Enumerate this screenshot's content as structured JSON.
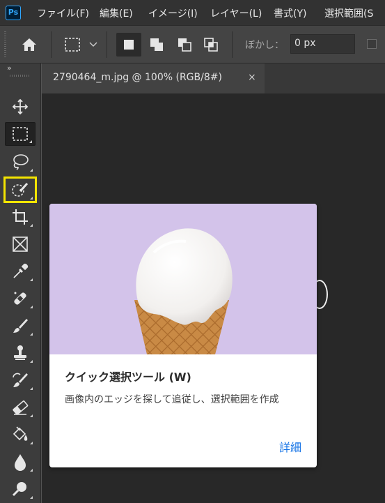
{
  "app": {
    "logo_text": "Ps",
    "accent": "#31a8ff"
  },
  "menu": [
    "ファイル(F)",
    "編集(E)",
    "イメージ(I)",
    "レイヤー(L)",
    "書式(Y)",
    "選択範囲(S"
  ],
  "options_bar": {
    "icons": [
      "home-icon",
      "rect-marquee-preset-icon",
      "chevron-down-icon",
      "new-selection-icon",
      "add-to-selection-icon",
      "subtract-from-selection-icon",
      "intersect-selection-icon"
    ],
    "feather_label": "ぼかし：",
    "feather_value": "0 px"
  },
  "toolbar": {
    "collapse": "»",
    "tools": [
      "move-tool",
      "rectangular-marquee-tool",
      "lasso-tool",
      "quick-selection-tool",
      "crop-tool",
      "frame-tool",
      "eyedropper-tool",
      "spot-healing-brush-tool",
      "brush-tool",
      "clone-stamp-tool",
      "history-brush-tool",
      "eraser-tool",
      "paint-bucket-tool",
      "blur-tool",
      "dodge-tool"
    ],
    "active_tool": "rectangular-marquee-tool",
    "highlighted_tool": "quick-selection-tool",
    "highlight_color": "#f4e500"
  },
  "document": {
    "tab_title": "2790464_m.jpg @ 100% (RGB/8#)",
    "close": "×"
  },
  "tooltip": {
    "title": "クイック選択ツール (W)",
    "description": "画像内のエッジを探して追従し、選択範囲を作成",
    "link": "詳細",
    "image": "ice-cream-cone-illustration",
    "image_bg": "#d3c3ea"
  }
}
